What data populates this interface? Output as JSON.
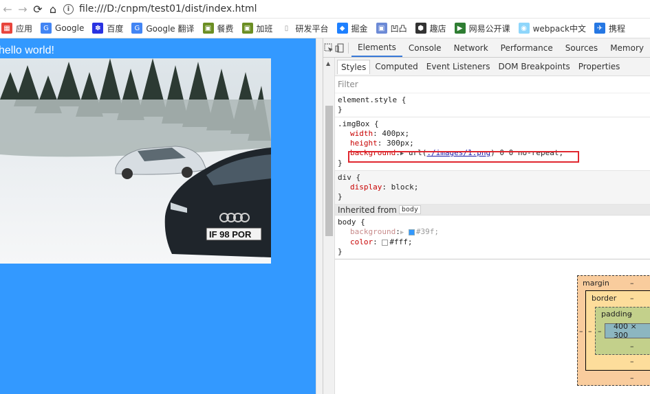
{
  "address_bar": {
    "back": "←",
    "forward": "→",
    "reload": "⟳",
    "home": "⌂",
    "info": "i",
    "url": "file:///D:/cnpm/test01/dist/index.html"
  },
  "bookmarks": [
    {
      "label": "应用",
      "icon": "apps-grid-icon",
      "color": "#e8453c"
    },
    {
      "label": "Google",
      "icon": "google-icon",
      "color": "#4285f4"
    },
    {
      "label": "百度",
      "icon": "baidu-paw-icon",
      "color": "#2932e1"
    },
    {
      "label": "Google 翻译",
      "icon": "google-translate-icon",
      "color": "#4285f4"
    },
    {
      "label": "餐费",
      "icon": "image-icon",
      "color": "#6b8e23"
    },
    {
      "label": "加班",
      "icon": "image-icon",
      "color": "#6b8e23"
    },
    {
      "label": "研发平台",
      "icon": "page-icon",
      "color": "#999999"
    },
    {
      "label": "掘金",
      "icon": "juejin-icon",
      "color": "#1e80ff"
    },
    {
      "label": "凹凸",
      "icon": "aotu-icon",
      "color": "#6c8ad6"
    },
    {
      "label": "趣店",
      "icon": "qudian-icon",
      "color": "#333333"
    },
    {
      "label": "网易公开课",
      "icon": "netease-icon",
      "color": "#2e7d32"
    },
    {
      "label": "webpack中文",
      "icon": "webpack-icon",
      "color": "#8ed6fb"
    },
    {
      "label": "携程",
      "icon": "ctrip-icon",
      "color": "#2577e3"
    }
  ],
  "page": {
    "heading": "hello world!",
    "background": "#3399ff"
  },
  "devtools": {
    "tabs": [
      "Elements",
      "Console",
      "Network",
      "Performance",
      "Sources",
      "Memory"
    ],
    "selected_tab": "Elements",
    "subtabs": [
      "Styles",
      "Computed",
      "Event Listeners",
      "DOM Breakpoints",
      "Properties"
    ],
    "filter_placeholder": "Filter",
    "rules": {
      "element_style": {
        "selector": "element.style {",
        "close": "}"
      },
      "imgbox": {
        "selector": ".imgBox {",
        "width_name": "width",
        "width_value": "400px;",
        "height_name": "height",
        "height_value": "300px;",
        "bg_name": "background",
        "bg_url_prefix": "url(",
        "bg_url": "./images/1.png",
        "bg_url_suffix": ") 0 0 no-repeat;",
        "close": "}"
      },
      "div": {
        "selector": "div {",
        "prop_name": "display",
        "prop_value": "block;",
        "source": "",
        "close": "}"
      },
      "inherited_label": "Inherited from",
      "inherited_tag": "body",
      "body": {
        "selector": "body {",
        "bg_name": "background",
        "bg_value": "#39f;",
        "color_name": "color",
        "color_value": "#fff;",
        "close": "}"
      }
    },
    "box_model": {
      "margin_label": "margin",
      "border_label": "border",
      "padding_label": "padding",
      "dash": "–",
      "content": "400 × 300"
    }
  }
}
